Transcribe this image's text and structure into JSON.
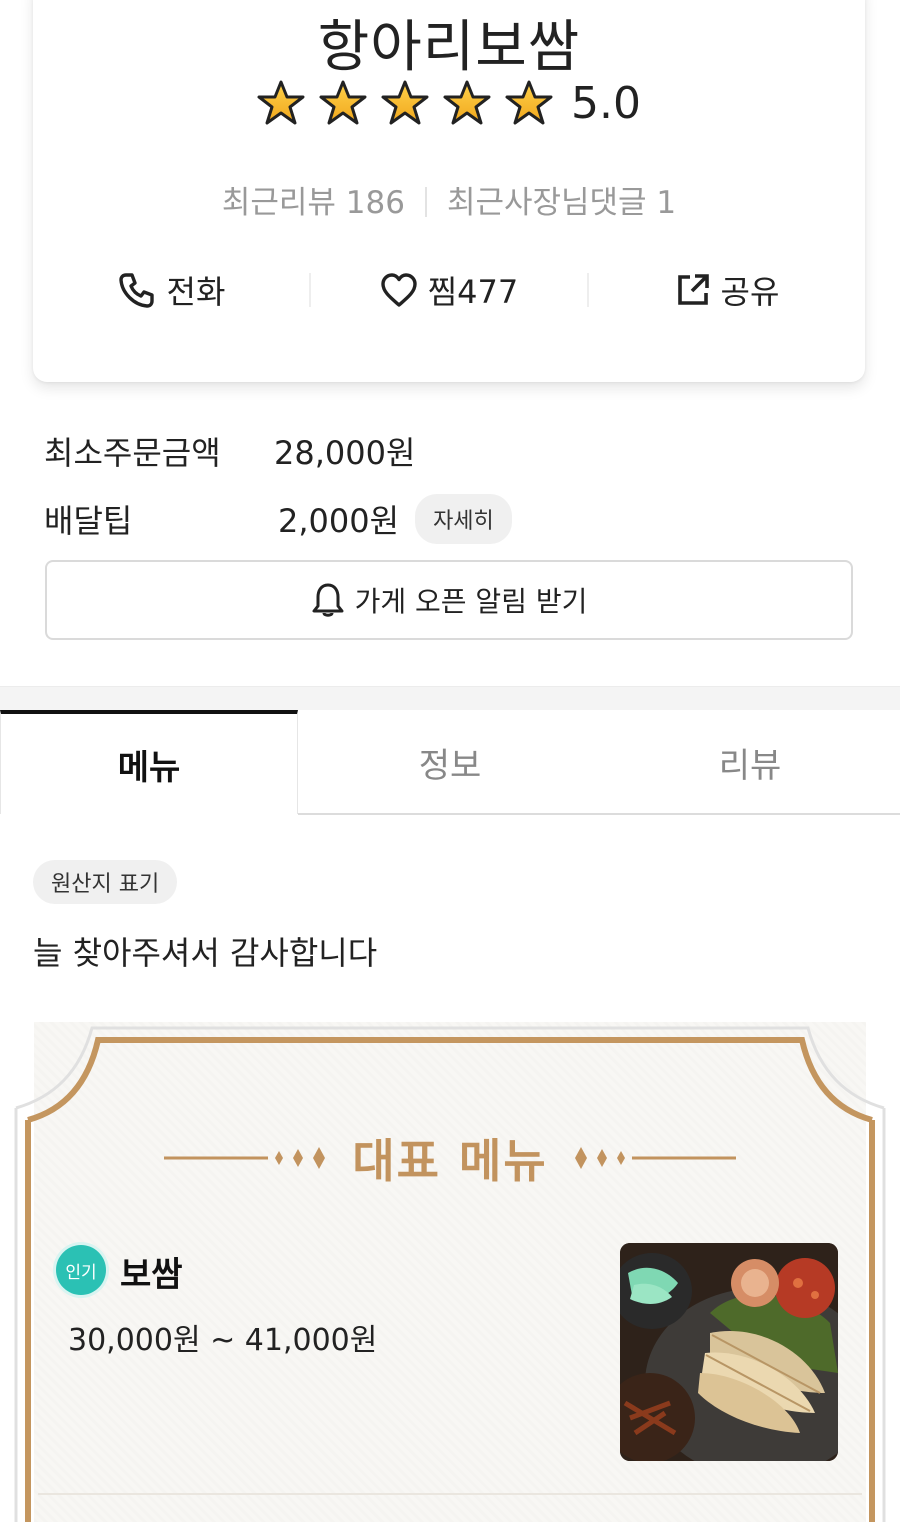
{
  "store": {
    "name": "항아리보쌈",
    "rating": "5.0",
    "stars_filled": 5,
    "stars_total": 5,
    "recent_reviews": "최근리뷰 186",
    "recent_owner_replies": "최근사장님댓글 1"
  },
  "actions": {
    "call": "전화",
    "like": "찜477",
    "share": "공유"
  },
  "order_info": {
    "min_order_label": "최소주문금액",
    "min_order_value": "28,000원",
    "delivery_tip_label": "배달팁",
    "delivery_tip_value": "2,000원",
    "detail_chip": "자세히"
  },
  "alarm_button": "가게 오픈 알림 받기",
  "tabs": [
    {
      "label": "메뉴",
      "active": true
    },
    {
      "label": "정보",
      "active": false
    },
    {
      "label": "리뷰",
      "active": false
    }
  ],
  "origin_chip": "원산지 표기",
  "notice": "늘 찾아주셔서 감사합니다",
  "signature": {
    "title": "대표 메뉴",
    "item": {
      "badge": "인기",
      "name": "보쌈",
      "price": "30,000원 ~ 41,000원"
    }
  },
  "colors": {
    "star": "#f5b62a",
    "accent_gold": "#c2935e",
    "popular_badge": "#2bc1b4"
  }
}
